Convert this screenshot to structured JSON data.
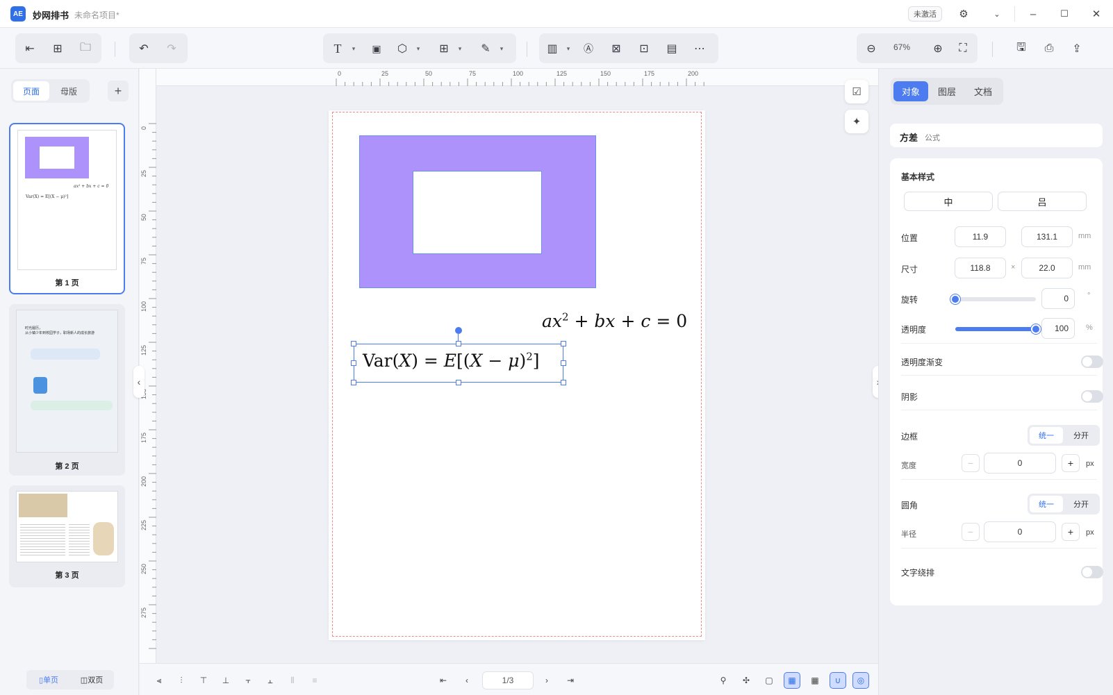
{
  "title": {
    "app_name": "妙网排书",
    "project_name": "未命名项目*",
    "activate": "未激活",
    "logo_text": "AE"
  },
  "toolbar": {
    "zoom": "67%"
  },
  "left_panel": {
    "tab_pages": "页面",
    "tab_masters": "母版",
    "add": "+",
    "pages": [
      {
        "label": "第 1 页",
        "formula1": "ax² + bx + c = 0",
        "formula2": "Var(X) = E[(X − μ)²]"
      },
      {
        "label": "第 2 页",
        "line1": "时光履历，",
        "line2": "从小镇少年到校园学子，职场新人的成长旅游"
      },
      {
        "label": "第 3 页"
      }
    ],
    "view_single": "单页",
    "view_double": "双页"
  },
  "ruler": {
    "h_ticks": [
      "0",
      "25",
      "50",
      "75",
      "100",
      "125",
      "150",
      "175",
      "200"
    ],
    "v_ticks": [
      "0",
      "25",
      "50",
      "75",
      "100",
      "125",
      "150",
      "175",
      "200",
      "225",
      "250",
      "275"
    ]
  },
  "canvas": {
    "formula_quad": {
      "a": "a",
      "x": "x",
      "sup": "2",
      "plus1": " + ",
      "b": "b",
      "x2": "x",
      "plus2": " + ",
      "c": "c",
      "eq": " = 0"
    },
    "formula_var": {
      "var": "Var(",
      "X": "X",
      "close": ")",
      "eq": " = ",
      "E": "E",
      "open": "[(",
      "X2": "X",
      "minus": " − ",
      "mu": "μ",
      "close2": ")",
      "sup": "2",
      "end": "]"
    }
  },
  "bottom": {
    "page_indicator": "1/3"
  },
  "right_panel": {
    "tabs": [
      "对象",
      "图层",
      "文档"
    ],
    "object_name": "方差",
    "object_type": "公式",
    "section_basic": "基本样式",
    "align_center": "中",
    "align_middle": "吕",
    "position_label": "位置",
    "pos_x": "11.9",
    "pos_y": "131.1",
    "size_label": "尺寸",
    "width": "118.8",
    "times": "×",
    "height": "22.0",
    "unit_mm": "mm",
    "rotation_label": "旋转",
    "rotation": "0",
    "rotation_value": 0,
    "degree": "°",
    "opacity_label": "透明度",
    "opacity": "100",
    "opacity_value": 100,
    "percent": "%",
    "opacity_gradient": "透明度渐变",
    "shadow": "阴影",
    "border_label": "边框",
    "seg_unified": "统一",
    "seg_separate": "分开",
    "border_width_label": "宽度",
    "border_width": "0",
    "unit_px": "px",
    "radius_label": "圆角",
    "radius_sub_label": "半径",
    "radius": "0",
    "text_wrap": "文字绕排"
  }
}
